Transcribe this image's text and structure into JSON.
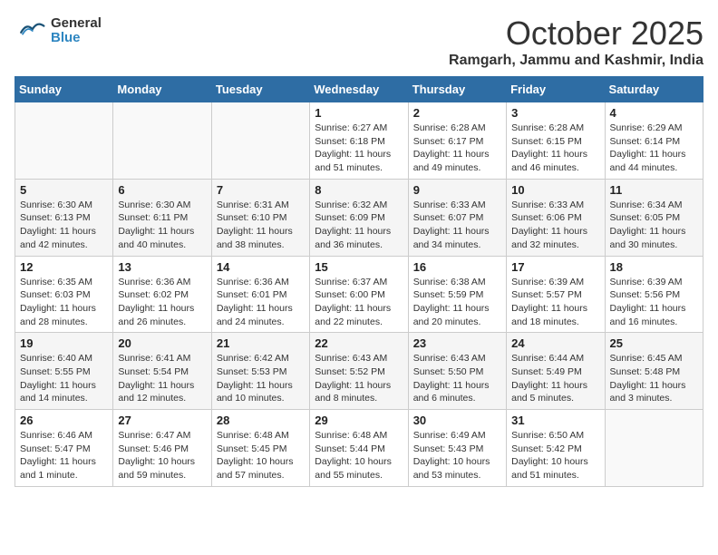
{
  "header": {
    "logo_general": "General",
    "logo_blue": "Blue",
    "month_title": "October 2025",
    "location": "Ramgarh, Jammu and Kashmir, India"
  },
  "calendar": {
    "days_of_week": [
      "Sunday",
      "Monday",
      "Tuesday",
      "Wednesday",
      "Thursday",
      "Friday",
      "Saturday"
    ],
    "weeks": [
      [
        {
          "day": "",
          "info": ""
        },
        {
          "day": "",
          "info": ""
        },
        {
          "day": "",
          "info": ""
        },
        {
          "day": "1",
          "info": "Sunrise: 6:27 AM\nSunset: 6:18 PM\nDaylight: 11 hours\nand 51 minutes."
        },
        {
          "day": "2",
          "info": "Sunrise: 6:28 AM\nSunset: 6:17 PM\nDaylight: 11 hours\nand 49 minutes."
        },
        {
          "day": "3",
          "info": "Sunrise: 6:28 AM\nSunset: 6:15 PM\nDaylight: 11 hours\nand 46 minutes."
        },
        {
          "day": "4",
          "info": "Sunrise: 6:29 AM\nSunset: 6:14 PM\nDaylight: 11 hours\nand 44 minutes."
        }
      ],
      [
        {
          "day": "5",
          "info": "Sunrise: 6:30 AM\nSunset: 6:13 PM\nDaylight: 11 hours\nand 42 minutes."
        },
        {
          "day": "6",
          "info": "Sunrise: 6:30 AM\nSunset: 6:11 PM\nDaylight: 11 hours\nand 40 minutes."
        },
        {
          "day": "7",
          "info": "Sunrise: 6:31 AM\nSunset: 6:10 PM\nDaylight: 11 hours\nand 38 minutes."
        },
        {
          "day": "8",
          "info": "Sunrise: 6:32 AM\nSunset: 6:09 PM\nDaylight: 11 hours\nand 36 minutes."
        },
        {
          "day": "9",
          "info": "Sunrise: 6:33 AM\nSunset: 6:07 PM\nDaylight: 11 hours\nand 34 minutes."
        },
        {
          "day": "10",
          "info": "Sunrise: 6:33 AM\nSunset: 6:06 PM\nDaylight: 11 hours\nand 32 minutes."
        },
        {
          "day": "11",
          "info": "Sunrise: 6:34 AM\nSunset: 6:05 PM\nDaylight: 11 hours\nand 30 minutes."
        }
      ],
      [
        {
          "day": "12",
          "info": "Sunrise: 6:35 AM\nSunset: 6:03 PM\nDaylight: 11 hours\nand 28 minutes."
        },
        {
          "day": "13",
          "info": "Sunrise: 6:36 AM\nSunset: 6:02 PM\nDaylight: 11 hours\nand 26 minutes."
        },
        {
          "day": "14",
          "info": "Sunrise: 6:36 AM\nSunset: 6:01 PM\nDaylight: 11 hours\nand 24 minutes."
        },
        {
          "day": "15",
          "info": "Sunrise: 6:37 AM\nSunset: 6:00 PM\nDaylight: 11 hours\nand 22 minutes."
        },
        {
          "day": "16",
          "info": "Sunrise: 6:38 AM\nSunset: 5:59 PM\nDaylight: 11 hours\nand 20 minutes."
        },
        {
          "day": "17",
          "info": "Sunrise: 6:39 AM\nSunset: 5:57 PM\nDaylight: 11 hours\nand 18 minutes."
        },
        {
          "day": "18",
          "info": "Sunrise: 6:39 AM\nSunset: 5:56 PM\nDaylight: 11 hours\nand 16 minutes."
        }
      ],
      [
        {
          "day": "19",
          "info": "Sunrise: 6:40 AM\nSunset: 5:55 PM\nDaylight: 11 hours\nand 14 minutes."
        },
        {
          "day": "20",
          "info": "Sunrise: 6:41 AM\nSunset: 5:54 PM\nDaylight: 11 hours\nand 12 minutes."
        },
        {
          "day": "21",
          "info": "Sunrise: 6:42 AM\nSunset: 5:53 PM\nDaylight: 11 hours\nand 10 minutes."
        },
        {
          "day": "22",
          "info": "Sunrise: 6:43 AM\nSunset: 5:52 PM\nDaylight: 11 hours\nand 8 minutes."
        },
        {
          "day": "23",
          "info": "Sunrise: 6:43 AM\nSunset: 5:50 PM\nDaylight: 11 hours\nand 6 minutes."
        },
        {
          "day": "24",
          "info": "Sunrise: 6:44 AM\nSunset: 5:49 PM\nDaylight: 11 hours\nand 5 minutes."
        },
        {
          "day": "25",
          "info": "Sunrise: 6:45 AM\nSunset: 5:48 PM\nDaylight: 11 hours\nand 3 minutes."
        }
      ],
      [
        {
          "day": "26",
          "info": "Sunrise: 6:46 AM\nSunset: 5:47 PM\nDaylight: 11 hours\nand 1 minute."
        },
        {
          "day": "27",
          "info": "Sunrise: 6:47 AM\nSunset: 5:46 PM\nDaylight: 10 hours\nand 59 minutes."
        },
        {
          "day": "28",
          "info": "Sunrise: 6:48 AM\nSunset: 5:45 PM\nDaylight: 10 hours\nand 57 minutes."
        },
        {
          "day": "29",
          "info": "Sunrise: 6:48 AM\nSunset: 5:44 PM\nDaylight: 10 hours\nand 55 minutes."
        },
        {
          "day": "30",
          "info": "Sunrise: 6:49 AM\nSunset: 5:43 PM\nDaylight: 10 hours\nand 53 minutes."
        },
        {
          "day": "31",
          "info": "Sunrise: 6:50 AM\nSunset: 5:42 PM\nDaylight: 10 hours\nand 51 minutes."
        },
        {
          "day": "",
          "info": ""
        }
      ]
    ]
  }
}
